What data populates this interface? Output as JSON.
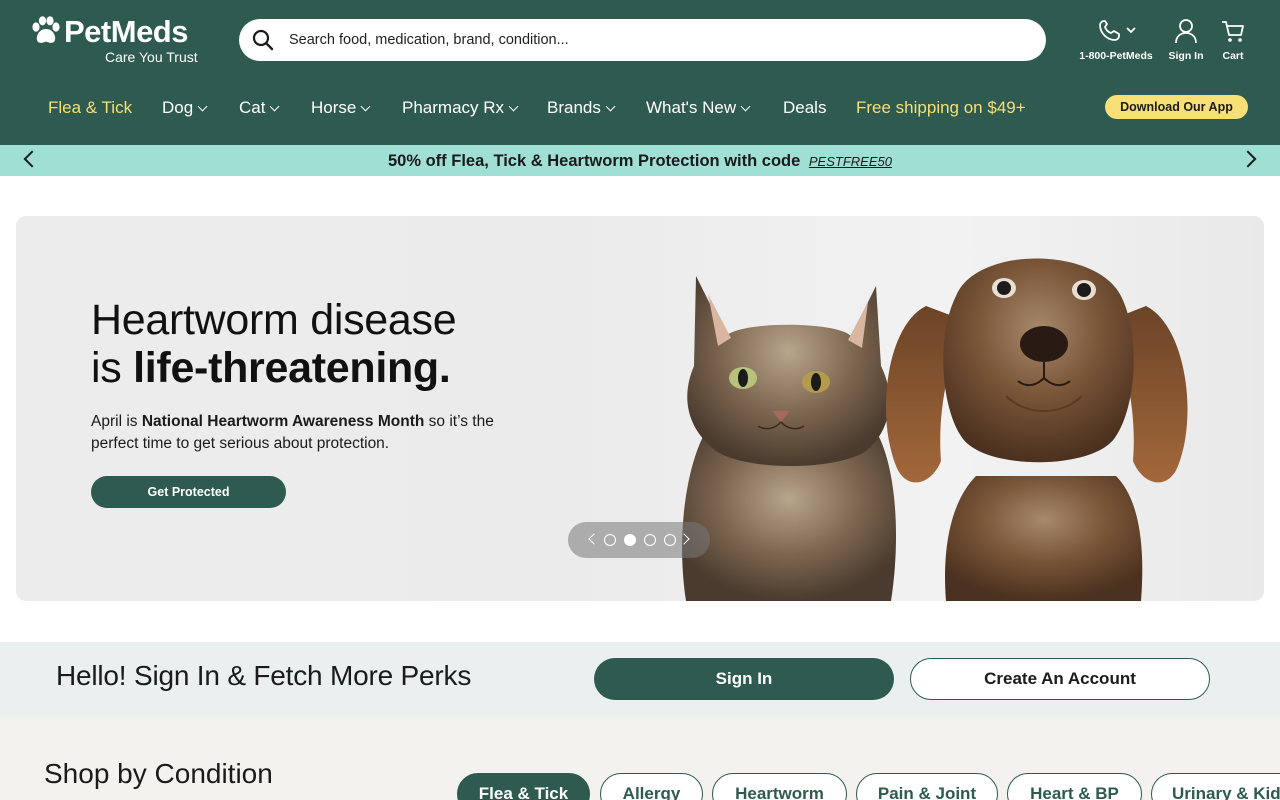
{
  "header": {
    "brand": "PetMeds",
    "tagline": "Care You Trust",
    "search_placeholder": "Search food, medication, brand, condition...",
    "phone_label": "1-800-PetMeds",
    "signin_label": "Sign In",
    "cart_label": "Cart",
    "download_app": "Download Our App",
    "background": "#2e5a4f",
    "accent_yellow": "#f8df76"
  },
  "nav": {
    "items": [
      {
        "label": "Flea & Tick"
      },
      {
        "label": "Dog"
      },
      {
        "label": "Cat"
      },
      {
        "label": "Horse"
      },
      {
        "label": "Pharmacy Rx"
      },
      {
        "label": "Brands"
      },
      {
        "label": "What's New"
      },
      {
        "label": "Deals"
      },
      {
        "label": "Free shipping on $49+"
      }
    ]
  },
  "promo": {
    "message": "50% off Flea, Tick & Heartworm Protection with code",
    "code": "PESTFREE50",
    "background": "#9fdfd4"
  },
  "hero": {
    "headline_line1": "Heartworm disease",
    "headline_line2_prefix": "is",
    "headline_line2_bold": "life-threatening.",
    "sub_prefix": "April is",
    "sub_bold": "National Heartworm Awareness Month",
    "sub_suffix": "so it’s the perfect time to get serious about protection.",
    "cta": "Get Protected",
    "slide_count": 4,
    "active_slide": 2
  },
  "perks": {
    "heading": "Hello! Sign In & Fetch More Perks",
    "signin_button": "Sign In",
    "create_button": "Create An Account"
  },
  "shop": {
    "heading": "Shop by Condition",
    "chips": [
      {
        "label": "Flea & Tick"
      },
      {
        "label": "Allergy"
      },
      {
        "label": "Heartworm"
      },
      {
        "label": "Pain & Joint"
      },
      {
        "label": "Heart & BP"
      },
      {
        "label": "Urinary & Kidney"
      }
    ]
  }
}
